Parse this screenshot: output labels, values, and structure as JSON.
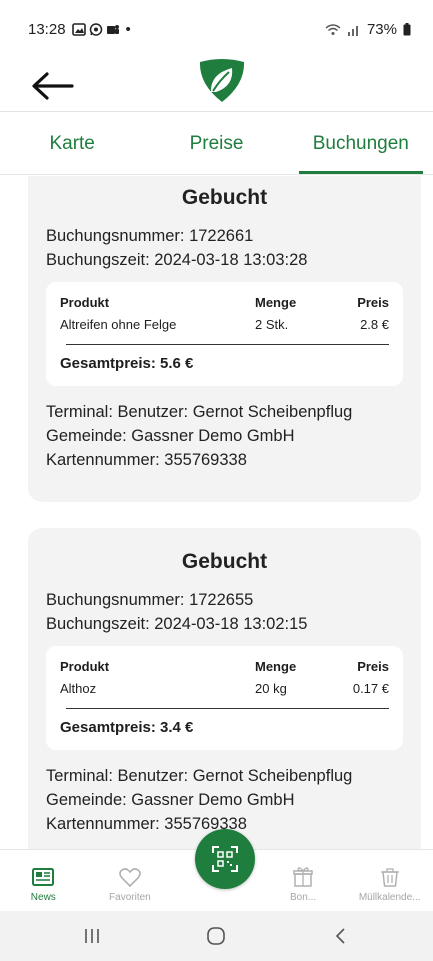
{
  "status_bar": {
    "time": "13:28",
    "dot": "•",
    "battery": "73%",
    "icons": [
      "gallery-icon",
      "whatsapp-icon",
      "teams-icon",
      "wifi-icon",
      "signal-icon",
      "battery-icon"
    ]
  },
  "header": {
    "back_icon": "arrow-left-icon",
    "logo": "leaf-shield-logo"
  },
  "tabs": [
    {
      "label": "Karte",
      "active": false
    },
    {
      "label": "Preise",
      "active": false
    },
    {
      "label": "Buchungen",
      "active": true
    }
  ],
  "bookings": [
    {
      "status": "Gebucht",
      "number_line": "Buchungsnummer: 1722661",
      "time_line": "Buchungszeit: 2024-03-18 13:03:28",
      "table_headers": {
        "product": "Produkt",
        "quantity": "Menge",
        "price": "Preis"
      },
      "items": [
        {
          "product": "Altreifen ohne Felge",
          "quantity": "2 Stk.",
          "price": "2.8 €"
        }
      ],
      "total": "Gesamtpreis: 5.6 €",
      "terminal": "Terminal: Benutzer: Gernot Scheibenpflug",
      "municipality": "Gemeinde: Gassner Demo GmbH",
      "card_number": "Kartennummer: 355769338"
    },
    {
      "status": "Gebucht",
      "number_line": "Buchungsnummer: 1722655",
      "time_line": "Buchungszeit: 2024-03-18 13:02:15",
      "table_headers": {
        "product": "Produkt",
        "quantity": "Menge",
        "price": "Preis"
      },
      "items": [
        {
          "product": "Althoz",
          "quantity": "20 kg",
          "price": "0.17 €"
        }
      ],
      "total": "Gesamtpreis: 3.4 €",
      "terminal": "Terminal: Benutzer: Gernot Scheibenpflug",
      "municipality": "Gemeinde: Gassner Demo GmbH",
      "card_number": "Kartennummer: 355769338"
    }
  ],
  "bottom_nav": [
    {
      "label": "News",
      "icon": "news-icon",
      "active": true
    },
    {
      "label": "Favoriten",
      "icon": "heart-icon",
      "active": false
    },
    {
      "label": "Bon...",
      "icon": "gift-icon",
      "active": false
    },
    {
      "label": "Müllkalende...",
      "icon": "trash-icon",
      "active": false
    }
  ],
  "scan_button": {
    "icon": "qr-scan-icon"
  },
  "colors": {
    "brand": "#1f7d3d",
    "card_bg": "#f3f3f3",
    "inactive": "#a6a6a6"
  }
}
